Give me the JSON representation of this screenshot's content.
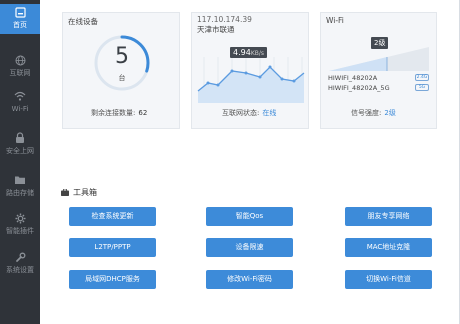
{
  "sidebar": {
    "items": [
      {
        "label": "首页",
        "icon": "home-icon",
        "active": true
      },
      {
        "label": "互联网",
        "icon": "globe-icon",
        "active": false
      },
      {
        "label": "Wi-Fi",
        "icon": "wifi-icon",
        "active": false
      },
      {
        "label": "安全上网",
        "icon": "lock-icon",
        "active": false
      },
      {
        "label": "路由存储",
        "icon": "folder-icon",
        "active": false
      },
      {
        "label": "智能插件",
        "icon": "gear-icon",
        "active": false
      },
      {
        "label": "系统设置",
        "icon": "wrench-icon",
        "active": false
      }
    ]
  },
  "devices": {
    "title": "在线设备",
    "count": "5",
    "unit": "台",
    "remain_label": "剩余连接数量:",
    "remain_value": "62",
    "ring_fraction": 0.3
  },
  "internet": {
    "ip": "117.10.174.39",
    "isp": "天津市联通",
    "speed": "4.94",
    "speed_unit": "KB/s",
    "status_label": "互联网状态:",
    "status_value": "在线"
  },
  "wifi": {
    "title": "Wi-Fi",
    "level_badge": "2级",
    "ssid_24": "HIWIFI_48202A",
    "band_24": "2.4G",
    "ssid_5": "HIWIFI_48202A_5G",
    "band_5": "5G",
    "signal_label": "信号强度:",
    "signal_value": "2级"
  },
  "toolbox": {
    "title": "工具箱",
    "buttons": [
      "检查系统更新",
      "智能Qos",
      "朋友专享网络",
      "L2TP/PPTP",
      "设备限速",
      "MAC地址克隆",
      "局域网DHCP服务",
      "修改Wi-Fi密码",
      "切换Wi-Fi信道"
    ]
  },
  "colors": {
    "accent": "#3c8ad8",
    "sidebar": "#2f3339"
  }
}
